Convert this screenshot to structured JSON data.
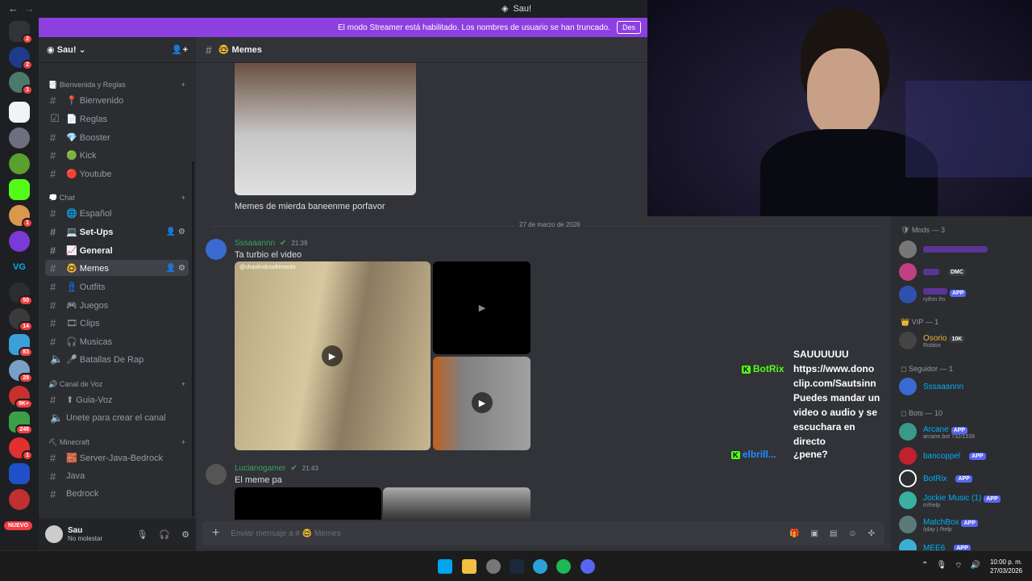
{
  "window": {
    "title": "Sau!"
  },
  "banner": {
    "text": "El modo Streamer está habilitado. Los nombres de usuario se han truncado.",
    "button": "Des"
  },
  "server_rail": {
    "badges": [
      "2",
      "2",
      "1",
      "1",
      "50",
      "14",
      "83",
      "28",
      "9K+",
      "248",
      "1"
    ],
    "new_label": "NUEVO"
  },
  "server": {
    "name": "Sau!"
  },
  "categories": [
    {
      "label": "📑 Bienvenida y Reglas"
    },
    {
      "label": "💭 Chat"
    },
    {
      "label": "🔊 Canal de Voz"
    },
    {
      "label": "⛏ Minecraft"
    }
  ],
  "channels": [
    {
      "label": "📍 Bienvenido"
    },
    {
      "label": "📄 Reglas"
    },
    {
      "label": "💎 Booster"
    },
    {
      "label": "🟢 Kick"
    },
    {
      "label": "🔴 Youtube"
    },
    {
      "label": "🌐 Español"
    },
    {
      "label": "💻 Set-Ups"
    },
    {
      "label": "📈 General"
    },
    {
      "label": "🤓 Memes"
    },
    {
      "label": "👖 Outfits"
    },
    {
      "label": "🎮 Juegos"
    },
    {
      "label": "🎞 Clips"
    },
    {
      "label": "🎧 Musicas"
    },
    {
      "label": "🎤 Batallas De Rap"
    },
    {
      "label": "⬆ Guia-Voz"
    },
    {
      "label": "Unete para crear el canal"
    },
    {
      "label": "🧱 Server-Java-Bedrock"
    },
    {
      "label": "Java"
    },
    {
      "label": "Bedrock"
    }
  ],
  "user": {
    "name": "Sau",
    "status": "No molestar"
  },
  "channel_header": {
    "name": "🤓 Memes"
  },
  "messages": {
    "m0_text": "Memes de mierda baneenme porfavor",
    "date_divider": "27 de marzo de 2026",
    "m1": {
      "author": "Sssaaannn",
      "time": "21:39",
      "text": "Ta turbio el video",
      "watermark": "@shaolindosofrimento"
    },
    "m2": {
      "author": "Lucianogamer",
      "time": "21:43",
      "text": "El meme pa"
    }
  },
  "composer": {
    "placeholder": "Enviar mensaje a # 🤓 Memes"
  },
  "members": {
    "cat_mods": "Mods — 3",
    "cat_vip": "VIP — 1",
    "cat_seg": "Seguidor — 1",
    "cat_bots": "Bots — 10",
    "mod2_tag": "DMC",
    "mod3_sub": "rythm.fm",
    "vip": {
      "name": "Osorio",
      "tag": "10K",
      "sub": "Roblox"
    },
    "seg": {
      "name": "Sssaaannn"
    },
    "bots": [
      {
        "name": "Arcane",
        "sub": "arcane.bot 732/1536"
      },
      {
        "name": "bancoppel",
        "sub": ""
      },
      {
        "name": "BotRix",
        "sub": ""
      },
      {
        "name": "Jockie Music (1)",
        "sub": "m!help"
      },
      {
        "name": "MatchBox",
        "sub": "/play | /help"
      },
      {
        "name": "MEE6",
        "sub": ""
      }
    ],
    "app_tag": "APP"
  },
  "overlay": {
    "name1": "BotRix",
    "name2": "elbrill...",
    "lines": [
      "SAUUUUUU",
      "https://www.dono",
      "clip.com/Sautsinn",
      "Puedes mandar un",
      "video o audio y se",
      "escuchara en",
      "directo",
      "¿pene?"
    ]
  },
  "taskbar": {
    "time": "10:00 p. m.",
    "date": "27/03/2026"
  }
}
